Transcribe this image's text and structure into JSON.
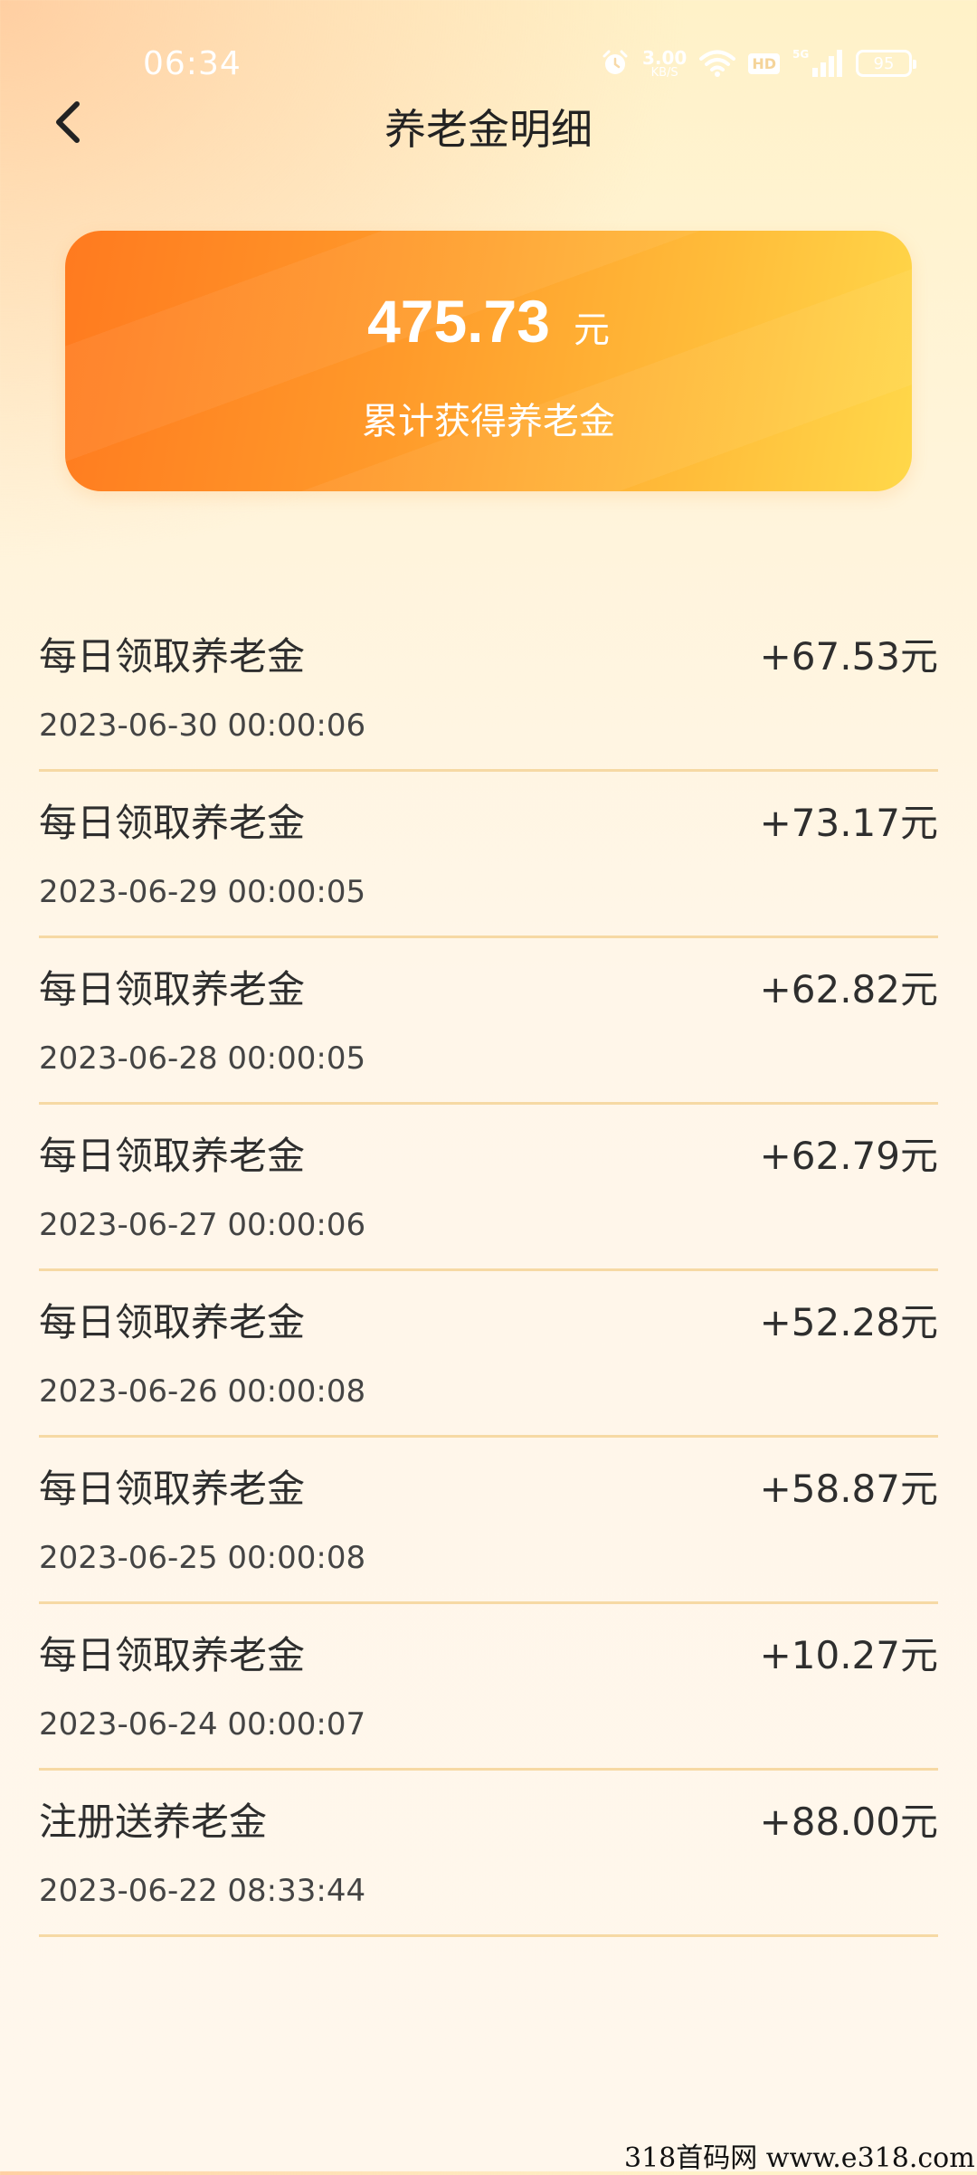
{
  "status_bar": {
    "time": "06:34",
    "net_speed_value": "3.00",
    "net_speed_unit": "KB/S",
    "hd": "HD",
    "network": "5G",
    "battery": "95"
  },
  "header": {
    "title": "养老金明细"
  },
  "summary": {
    "amount": "475.73",
    "unit": "元",
    "caption": "累计获得养老金"
  },
  "records": [
    {
      "title": "每日领取养老金",
      "amount": "+67.53元",
      "time": "2023-06-30 00:00:06"
    },
    {
      "title": "每日领取养老金",
      "amount": "+73.17元",
      "time": "2023-06-29 00:00:05"
    },
    {
      "title": "每日领取养老金",
      "amount": "+62.82元",
      "time": "2023-06-28 00:00:05"
    },
    {
      "title": "每日领取养老金",
      "amount": "+62.79元",
      "time": "2023-06-27 00:00:06"
    },
    {
      "title": "每日领取养老金",
      "amount": "+52.28元",
      "time": "2023-06-26 00:00:08"
    },
    {
      "title": "每日领取养老金",
      "amount": "+58.87元",
      "time": "2023-06-25 00:00:08"
    },
    {
      "title": "每日领取养老金",
      "amount": "+10.27元",
      "time": "2023-06-24 00:00:07"
    },
    {
      "title": "注册送养老金",
      "amount": "+88.00元",
      "time": "2023-06-22 08:33:44"
    }
  ],
  "watermark": "318首码网  www.e318.com"
}
